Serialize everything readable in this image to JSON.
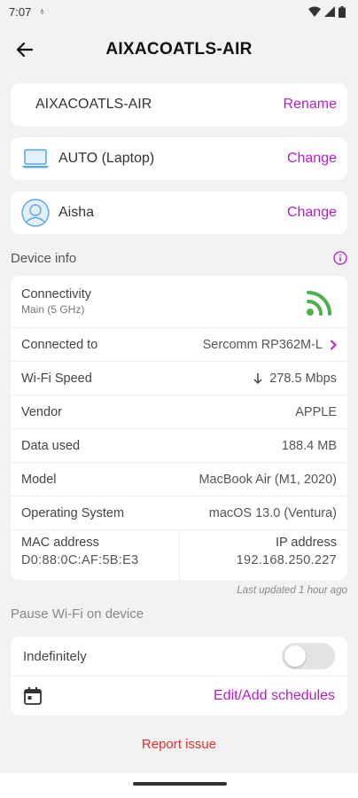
{
  "status_bar": {
    "time": "7:07"
  },
  "app_bar": {
    "title": "AIXACOATLS-AIR"
  },
  "name_card": {
    "name": "AIXACOATLS-AIR",
    "action": "Rename"
  },
  "type_card": {
    "label": "AUTO (Laptop)",
    "action": "Change"
  },
  "owner_card": {
    "label": "Aisha",
    "action": "Change"
  },
  "device_info": {
    "header": "Device info",
    "connectivity": {
      "label": "Connectivity",
      "sub": "Main (5 GHz)"
    },
    "connected_to": {
      "label": "Connected to",
      "value": "Sercomm RP362M-L"
    },
    "wifi_speed": {
      "label": "Wi-Fi Speed",
      "value": "278.5 Mbps"
    },
    "vendor": {
      "label": "Vendor",
      "value": "APPLE"
    },
    "data_used": {
      "label": "Data used",
      "value": "188.4 MB"
    },
    "model": {
      "label": "Model",
      "value": "MacBook Air (M1, 2020)"
    },
    "os": {
      "label": "Operating System",
      "value": "macOS 13.0 (Ventura)"
    },
    "mac": {
      "label": "MAC address",
      "value": "D0:88:0C:AF:5B:E3"
    },
    "ip": {
      "label": "IP address",
      "value": "192.168.250.227"
    },
    "last_updated": "Last updated 1 hour ago"
  },
  "pause": {
    "title": "Pause Wi-Fi on device",
    "indefinitely": "Indefinitely",
    "toggle_on": false,
    "schedules": "Edit/Add schedules"
  },
  "report_issue": "Report issue",
  "colors": {
    "accent": "#b51dcc",
    "signal": "#4caf50",
    "danger": "#e2312d"
  }
}
